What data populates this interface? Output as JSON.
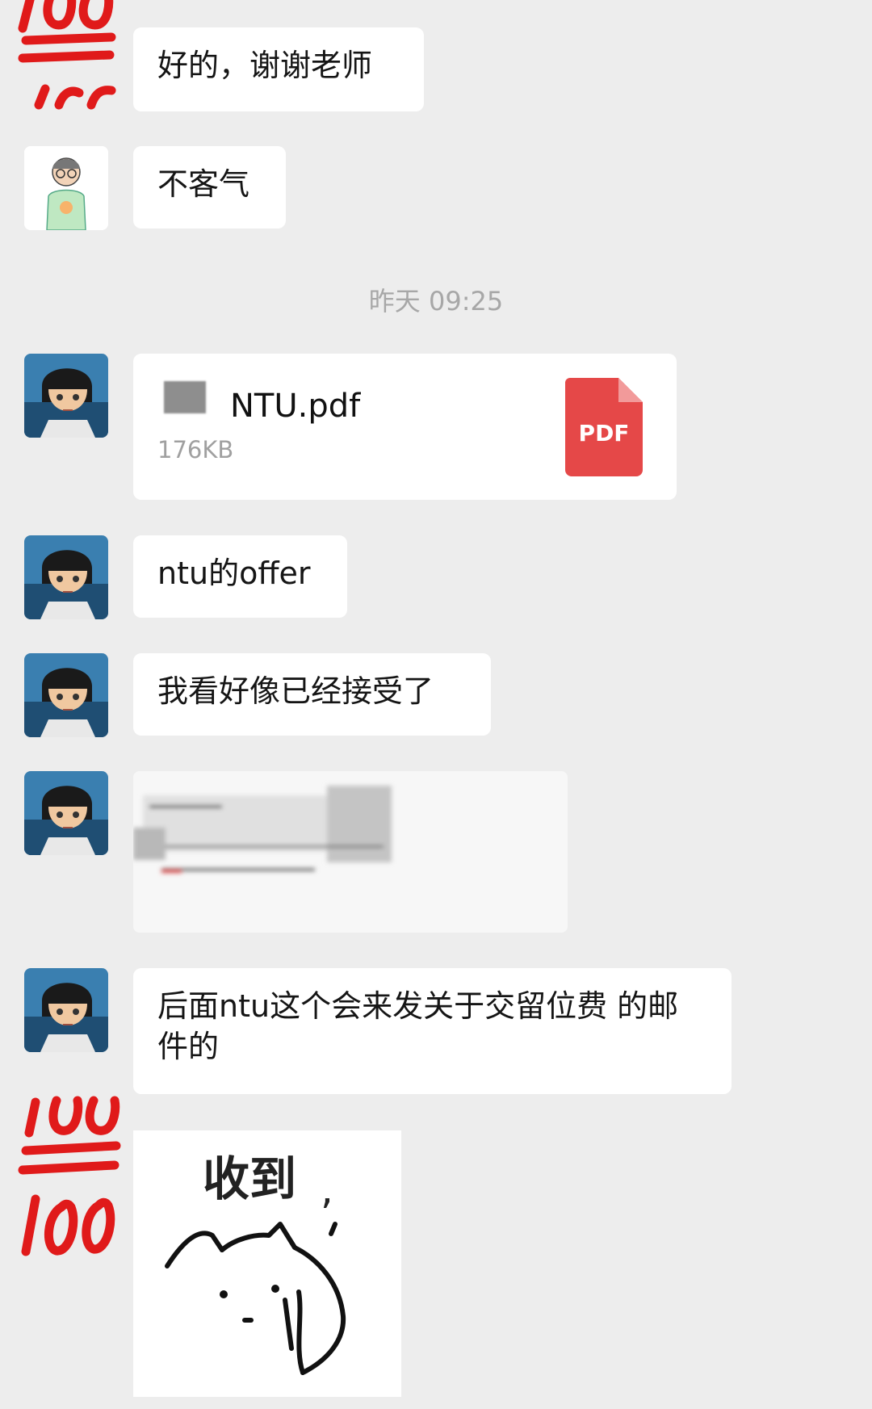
{
  "messages": {
    "m1": {
      "text": "好的，谢谢老师"
    },
    "m2": {
      "text": "不客气"
    },
    "timestamp": "昨天 09:25",
    "file": {
      "name": "NTU.pdf",
      "size": "176KB",
      "badge": "PDF"
    },
    "m4": {
      "text": "ntu的offer"
    },
    "m5": {
      "text": "我看好像已经接受了"
    },
    "m7": {
      "text": "后面ntu这个会来发关于交留位费 的邮件的"
    },
    "sticker": {
      "text": "收到"
    }
  },
  "avatars": {
    "hundred": {
      "label": "100"
    }
  },
  "colors": {
    "background": "#ededed",
    "bubble": "#ffffff",
    "pdf_red": "#e54848",
    "emoji_red": "#e01a1a"
  }
}
